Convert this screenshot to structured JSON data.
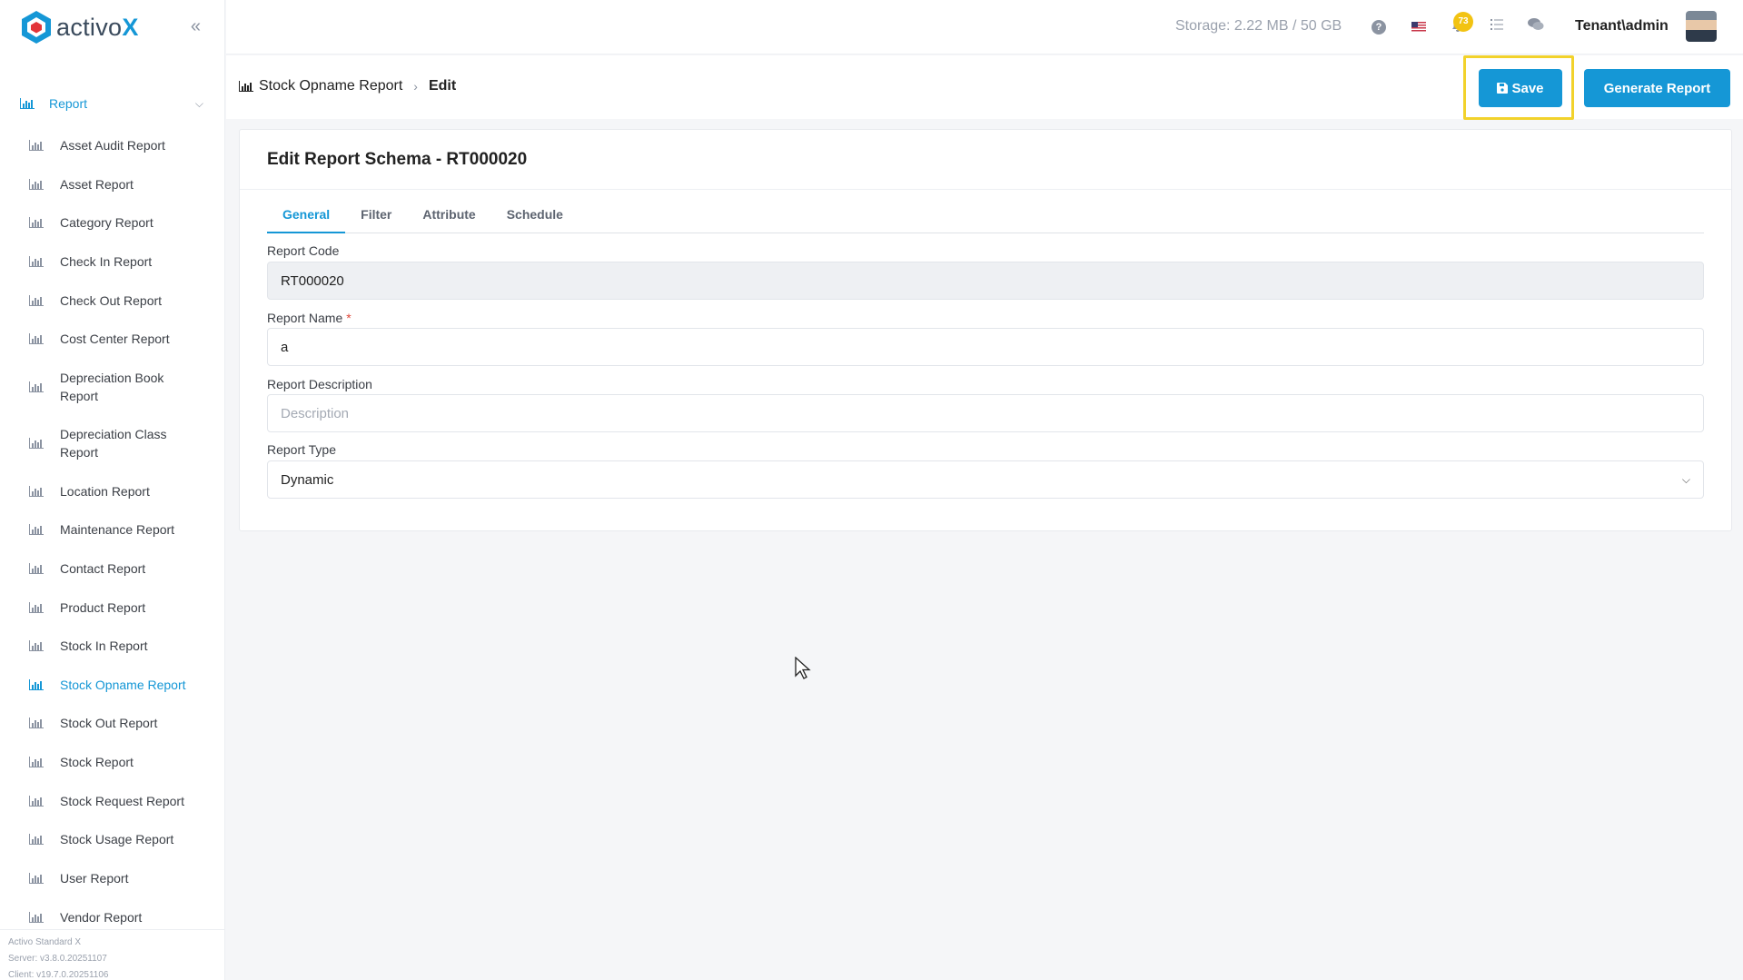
{
  "brand": {
    "name_prefix": "activo",
    "name_suffix": "X"
  },
  "sidebar": {
    "section_label": "Report",
    "items": [
      {
        "label": "Asset Audit Report",
        "active": false
      },
      {
        "label": "Asset Report",
        "active": false
      },
      {
        "label": "Category Report",
        "active": false
      },
      {
        "label": "Check In Report",
        "active": false
      },
      {
        "label": "Check Out Report",
        "active": false
      },
      {
        "label": "Cost Center Report",
        "active": false
      },
      {
        "label": "Depreciation Book Report",
        "active": false
      },
      {
        "label": "Depreciation Class Report",
        "active": false
      },
      {
        "label": "Location Report",
        "active": false
      },
      {
        "label": "Maintenance Report",
        "active": false
      },
      {
        "label": "Contact Report",
        "active": false
      },
      {
        "label": "Product Report",
        "active": false
      },
      {
        "label": "Stock In Report",
        "active": false
      },
      {
        "label": "Stock Opname Report",
        "active": true
      },
      {
        "label": "Stock Out Report",
        "active": false
      },
      {
        "label": "Stock Report",
        "active": false
      },
      {
        "label": "Stock Request Report",
        "active": false
      },
      {
        "label": "Stock Usage Report",
        "active": false
      },
      {
        "label": "User Report",
        "active": false
      },
      {
        "label": "Vendor Report",
        "active": false
      }
    ],
    "footer": {
      "product": "Activo Standard X",
      "server": "Server: v3.8.0.20251107",
      "client": "Client: v19.7.0.20251106"
    }
  },
  "header": {
    "storage": "Storage: 2.22 MB / 50 GB",
    "notification_count": "73",
    "user": "Tenant\\admin"
  },
  "breadcrumb": {
    "parent": "Stock Opname Report",
    "current": "Edit"
  },
  "actions": {
    "save_label": "Save",
    "generate_label": "Generate Report"
  },
  "card": {
    "title": "Edit Report Schema - RT000020",
    "tabs": [
      {
        "label": "General",
        "active": true
      },
      {
        "label": "Filter",
        "active": false
      },
      {
        "label": "Attribute",
        "active": false
      },
      {
        "label": "Schedule",
        "active": false
      }
    ],
    "fields": {
      "code_label": "Report Code",
      "code_value": "RT000020",
      "name_label": "Report Name",
      "name_required": "*",
      "name_value": "a",
      "desc_label": "Report Description",
      "desc_placeholder": "Description",
      "type_label": "Report Type",
      "type_value": "Dynamic"
    }
  },
  "colors": {
    "accent": "#1597d6",
    "highlight": "#f2d22b",
    "badge": "#f2c312",
    "required": "#e0483a"
  }
}
